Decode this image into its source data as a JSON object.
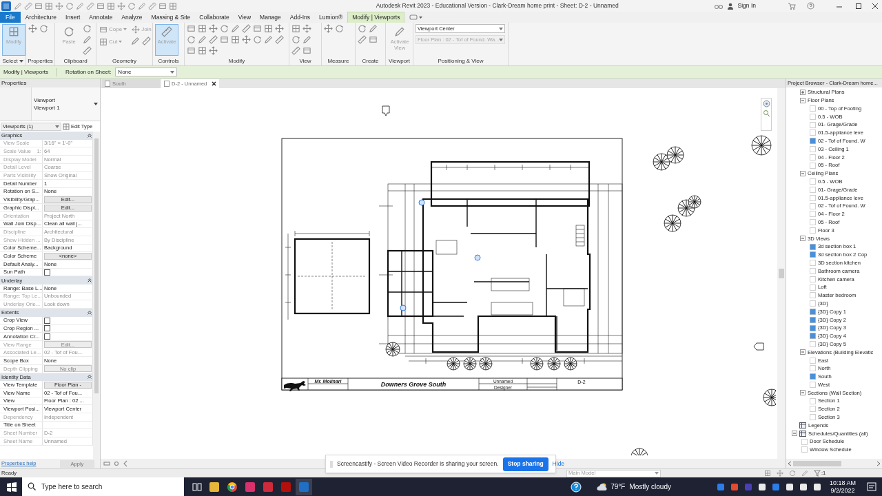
{
  "title_bar": {
    "title": "Autodesk Revit 2023 - Educational Version - Clark-Dream home print - Sheet: D-2 - Unnamed",
    "sign_in": "Sign In"
  },
  "menu_tabs": [
    {
      "label": "File",
      "kind": "file",
      "selected": false
    },
    {
      "label": "Architecture",
      "kind": "tab",
      "selected": false
    },
    {
      "label": "Insert",
      "kind": "tab",
      "selected": false
    },
    {
      "label": "Annotate",
      "kind": "tab",
      "selected": false
    },
    {
      "label": "Analyze",
      "kind": "tab",
      "selected": false
    },
    {
      "label": "Massing & Site",
      "kind": "tab",
      "selected": false
    },
    {
      "label": "Collaborate",
      "kind": "tab",
      "selected": false
    },
    {
      "label": "View",
      "kind": "tab",
      "selected": false
    },
    {
      "label": "Manage",
      "kind": "tab",
      "selected": false
    },
    {
      "label": "Add-Ins",
      "kind": "tab",
      "selected": false
    },
    {
      "label": "Lumion®",
      "kind": "tab",
      "selected": false
    },
    {
      "label": "Modify | Viewports",
      "kind": "tab",
      "selected": true
    }
  ],
  "ribbon": {
    "panels": [
      {
        "label": "Select",
        "dropdown": true,
        "buttons": [
          {
            "label": "Modify",
            "kind": "large",
            "active": true,
            "disabled": true
          }
        ]
      },
      {
        "label": "Properties",
        "dropdown": false
      },
      {
        "label": "Clipboard",
        "dropdown": false,
        "buttons": [
          {
            "label": "Paste",
            "kind": "large",
            "active": false,
            "disabled": true
          }
        ]
      },
      {
        "label": "Geometry",
        "dropdown": false,
        "buttons": [
          {
            "label": "Cope",
            "kind": "small",
            "active": false,
            "disabled": true
          },
          {
            "label": "Cut",
            "kind": "small",
            "active": false,
            "disabled": true
          },
          {
            "label": "Join",
            "kind": "small",
            "active": false,
            "disabled": true
          }
        ]
      },
      {
        "label": "Controls",
        "dropdown": false,
        "buttons": [
          {
            "label": "Activate",
            "kind": "large",
            "active": true,
            "disabled": true
          }
        ]
      },
      {
        "label": "Modify",
        "dropdown": false
      },
      {
        "label": "View",
        "dropdown": false
      },
      {
        "label": "Measure",
        "dropdown": false
      },
      {
        "label": "Create",
        "dropdown": false
      },
      {
        "label": "Viewport",
        "dropdown": false,
        "buttons": [
          {
            "label": "Activate View",
            "kind": "large",
            "active": false,
            "disabled": true
          }
        ]
      },
      {
        "label": "Positioning & View",
        "dropdown": false,
        "fields": [
          {
            "value": "Viewport Center",
            "disabled": false
          },
          {
            "value": "Floor Plan : 02 - Tof of Found. Wa...",
            "disabled": true
          }
        ]
      }
    ]
  },
  "options_bar": {
    "context": "Modify | Viewports",
    "rotation_label": "Rotation on Sheet:",
    "rotation_value": "None"
  },
  "properties": {
    "title": "Properties",
    "type_family": "Viewport",
    "type_name": "Viewport 1",
    "instance_filter": "Viewports (1)",
    "edit_type": "Edit Type",
    "help_link": "Properties help",
    "apply": "Apply",
    "sections": [
      {
        "name": "Graphics",
        "expanded": true,
        "rows": [
          {
            "label": "View Scale",
            "value": "3/16\" = 1'-0\"",
            "kind": "text",
            "disabled": true
          },
          {
            "label": "Scale Value    1:",
            "value": "64",
            "kind": "text",
            "disabled": true
          },
          {
            "label": "Display Model",
            "value": "Normal",
            "kind": "text",
            "disabled": true
          },
          {
            "label": "Detail Level",
            "value": "Coarse",
            "kind": "text",
            "disabled": true
          },
          {
            "label": "Parts Visibility",
            "value": "Show Original",
            "kind": "text",
            "disabled": true
          },
          {
            "label": "Detail Number",
            "value": "1",
            "kind": "text",
            "disabled": false
          },
          {
            "label": "Rotation on S...",
            "value": "None",
            "kind": "text",
            "disabled": false
          },
          {
            "label": "Visibility/Grap...",
            "value": "Edit...",
            "kind": "button",
            "disabled": false
          },
          {
            "label": "Graphic Displ...",
            "value": "Edit...",
            "kind": "button",
            "disabled": false
          },
          {
            "label": "Orientation",
            "value": "Project North",
            "kind": "text",
            "disabled": true
          },
          {
            "label": "Wall Join Disp...",
            "value": "Clean all wall j...",
            "kind": "text",
            "disabled": false
          },
          {
            "label": "Discipline",
            "value": "Architectural",
            "kind": "text",
            "disabled": true
          },
          {
            "label": "Show Hidden ...",
            "value": "By Discipline",
            "kind": "text",
            "disabled": true
          },
          {
            "label": "Color Scheme...",
            "value": "Background",
            "kind": "text",
            "disabled": false
          },
          {
            "label": "Color Scheme",
            "value": "<none>",
            "kind": "button",
            "disabled": false
          },
          {
            "label": "Default Analy...",
            "value": "None",
            "kind": "text",
            "disabled": false
          },
          {
            "label": "Sun Path",
            "kind": "checkbox",
            "checked": false,
            "disabled": false
          }
        ]
      },
      {
        "name": "Underlay",
        "expanded": true,
        "rows": [
          {
            "label": "Range: Base L...",
            "value": "None",
            "kind": "text",
            "disabled": false
          },
          {
            "label": "Range: Top Le...",
            "value": "Unbounded",
            "kind": "text",
            "disabled": true
          },
          {
            "label": "Underlay Orie...",
            "value": "Look down",
            "kind": "text",
            "disabled": true
          }
        ]
      },
      {
        "name": "Extents",
        "expanded": true,
        "rows": [
          {
            "label": "Crop View",
            "kind": "checkbox",
            "checked": false,
            "disabled": false
          },
          {
            "label": "Crop Region ...",
            "kind": "checkbox",
            "checked": false,
            "disabled": false
          },
          {
            "label": "Annotation Cr...",
            "kind": "checkbox",
            "checked": false,
            "disabled": false
          },
          {
            "label": "View Range",
            "value": "Edit...",
            "kind": "button",
            "disabled": true
          },
          {
            "label": "Associated Le...",
            "value": "02 - Tof of Fou...",
            "kind": "text",
            "disabled": true
          },
          {
            "label": "Scope Box",
            "value": "None",
            "kind": "text",
            "disabled": false
          },
          {
            "label": "Depth Clipping",
            "value": "No clip",
            "kind": "button",
            "disabled": true
          }
        ]
      },
      {
        "name": "Identity Data",
        "expanded": true,
        "rows": [
          {
            "label": "View Template",
            "value": "Floor Plan -",
            "kind": "button",
            "disabled": false
          },
          {
            "label": "View Name",
            "value": "02 - Tof of Fou...",
            "kind": "text",
            "disabled": false
          },
          {
            "label": "View",
            "value": "Floor Plan : 02 ...",
            "kind": "text",
            "disabled": false
          },
          {
            "label": "Viewport Posi...",
            "value": "Viewport Center",
            "kind": "text",
            "disabled": false
          },
          {
            "label": "Dependency",
            "value": "Independent",
            "kind": "text",
            "disabled": true
          },
          {
            "label": "Title on Sheet",
            "kind": "text",
            "disabled": false
          },
          {
            "label": "Sheet Number",
            "value": "D-2",
            "kind": "text",
            "disabled": true
          },
          {
            "label": "Sheet Name",
            "value": "Unnamed",
            "kind": "text",
            "disabled": true
          }
        ]
      }
    ]
  },
  "view_tabs": [
    {
      "label": "South",
      "selected": false
    },
    {
      "label": "D-2 - Unnamed",
      "selected": true
    }
  ],
  "title_block": {
    "designer_name": "Mr. Molinari",
    "title": "Downers Grove South",
    "sheet_name": "Unnamed",
    "drawn_by": "Designer",
    "sheet_number": "D-2"
  },
  "browser": {
    "title": "Project Browser - Clark-Dream home...",
    "tree": [
      {
        "label": "Structural Plans",
        "kind": "group",
        "expanded": false
      },
      {
        "label": "Floor Plans",
        "kind": "group",
        "expanded": true,
        "children": [
          {
            "label": "00 - Top of Footing",
            "kind": "view",
            "on_sheet": false
          },
          {
            "label": "0.5 - WOB",
            "kind": "view",
            "on_sheet": false
          },
          {
            "label": "01- Grage/Grade",
            "kind": "view",
            "on_sheet": false
          },
          {
            "label": "01.5-appliance leve",
            "kind": "view",
            "on_sheet": false
          },
          {
            "label": "02 - Tof of Found. W",
            "kind": "view",
            "on_sheet": true
          },
          {
            "label": "03 - Ceiling 1",
            "kind": "view",
            "on_sheet": false
          },
          {
            "label": "04 - Floor 2",
            "kind": "view",
            "on_sheet": false
          },
          {
            "label": "05 - Roof",
            "kind": "view",
            "on_sheet": false
          }
        ]
      },
      {
        "label": "Ceiling Plans",
        "kind": "group",
        "expanded": true,
        "children": [
          {
            "label": "0.5 - WOB",
            "kind": "view",
            "on_sheet": false
          },
          {
            "label": "01- Grage/Grade",
            "kind": "view",
            "on_sheet": false
          },
          {
            "label": "01.5-appliance leve",
            "kind": "view",
            "on_sheet": false
          },
          {
            "label": "02 - Tof of Found. W",
            "kind": "view",
            "on_sheet": false
          },
          {
            "label": "04 - Floor 2",
            "kind": "view",
            "on_sheet": false
          },
          {
            "label": "05 - Roof",
            "kind": "view",
            "on_sheet": false
          },
          {
            "label": "Floor 3",
            "kind": "view",
            "on_sheet": false
          }
        ]
      },
      {
        "label": "3D Views",
        "kind": "group",
        "expanded": true,
        "children": [
          {
            "label": "3d section box 1",
            "kind": "view",
            "on_sheet": true
          },
          {
            "label": "3d section box 2 Cop",
            "kind": "view",
            "on_sheet": true
          },
          {
            "label": "3D section kitchen",
            "kind": "view",
            "on_sheet": false
          },
          {
            "label": "Bathroom camera",
            "kind": "view",
            "on_sheet": false
          },
          {
            "label": "Kitchen camera",
            "kind": "view",
            "on_sheet": false
          },
          {
            "label": "Loft",
            "kind": "view",
            "on_sheet": false
          },
          {
            "label": "Master bedroom",
            "kind": "view",
            "on_sheet": false
          },
          {
            "label": "{3D}",
            "kind": "view",
            "on_sheet": false
          },
          {
            "label": "{3D} Copy 1",
            "kind": "view",
            "on_sheet": true
          },
          {
            "label": "{3D} Copy 2",
            "kind": "view",
            "on_sheet": true
          },
          {
            "label": "{3D} Copy 3",
            "kind": "view",
            "on_sheet": true
          },
          {
            "label": "{3D} Copy 4",
            "kind": "view",
            "on_sheet": true
          },
          {
            "label": "{3D} Copy 5",
            "kind": "view",
            "on_sheet": false
          }
        ]
      },
      {
        "label": "Elevations (Building Elevatic",
        "kind": "group",
        "expanded": true,
        "children": [
          {
            "label": "East",
            "kind": "view",
            "on_sheet": false
          },
          {
            "label": "North",
            "kind": "view",
            "on_sheet": false
          },
          {
            "label": "South",
            "kind": "view",
            "on_sheet": true
          },
          {
            "label": "West",
            "kind": "view",
            "on_sheet": false
          }
        ]
      },
      {
        "label": "Sections (Wall Section)",
        "kind": "group",
        "expanded": true,
        "children": [
          {
            "label": "Section 1",
            "kind": "view",
            "on_sheet": false
          },
          {
            "label": "Section 2",
            "kind": "view",
            "on_sheet": false
          },
          {
            "label": "Section 3",
            "kind": "view",
            "on_sheet": false
          }
        ]
      },
      {
        "label": "Legends",
        "kind": "category"
      },
      {
        "label": "Schedules/Quantities (all)",
        "kind": "category",
        "expanded": true,
        "children": [
          {
            "label": "Door Schedule",
            "kind": "view",
            "on_sheet": false
          },
          {
            "label": "Window Schedule",
            "kind": "view",
            "on_sheet": false
          }
        ]
      }
    ]
  },
  "status_bar": {
    "text": "Ready",
    "workset": "Main Model",
    "filter_count": ":1"
  },
  "screen_share": {
    "message": "Screencastify - Screen Video Recorder is sharing your screen.",
    "stop": "Stop sharing",
    "hide": "Hide"
  },
  "taskbar": {
    "search_placeholder": "Type here to search",
    "temperature": "79°F",
    "weather": "Mostly cloudy",
    "time": "10:18 AM",
    "date": "9/2/2022"
  }
}
